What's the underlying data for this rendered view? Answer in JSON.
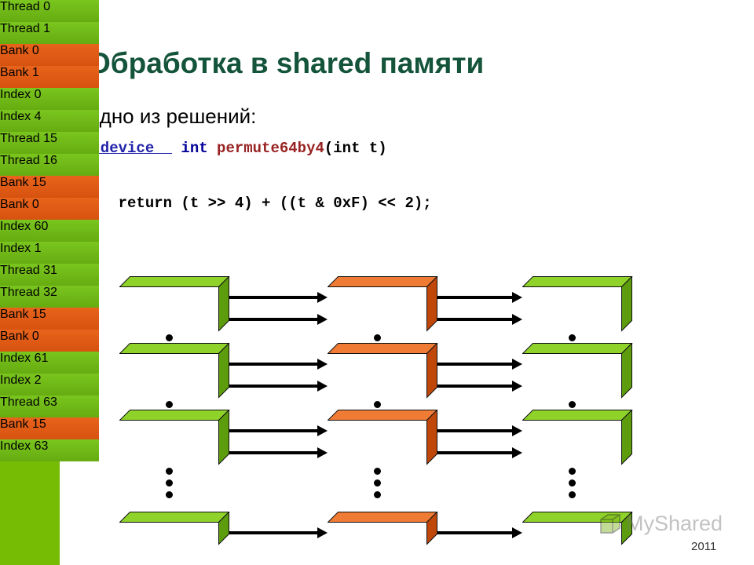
{
  "slide": {
    "title": "Обработка в shared памяти",
    "subtitle": "Одно из решений:",
    "title_color": "#14543b",
    "accent_bar_color": "#76bc05",
    "year": "2011"
  },
  "code": {
    "lines": [
      {
        "tokens": [
          {
            "text": "__device__",
            "kind": "keyword"
          },
          {
            "text": " int ",
            "kind": "keyword"
          },
          {
            "text": "permute64by4",
            "kind": "function"
          },
          {
            "text": "(int t)",
            "kind": "plain"
          }
        ]
      },
      {
        "tokens": [
          {
            "text": "{",
            "kind": "plain"
          }
        ]
      },
      {
        "tokens": [
          {
            "text": "    return (t >> 4) + ((t & 0xF) << 2);",
            "kind": "plain"
          }
        ]
      },
      {
        "tokens": [
          {
            "text": "}",
            "kind": "plain"
          }
        ]
      }
    ],
    "keyword_color": "#000099",
    "function_color": "#992222",
    "plain_color": "#000000"
  },
  "diagram": {
    "green_color": "#76bc05",
    "orange_color": "#e8641c",
    "columns": [
      {
        "name": "threads",
        "label_prefix": "Thread"
      },
      {
        "name": "banks",
        "label_prefix": "Bank"
      },
      {
        "name": "indices",
        "label_prefix": "Index"
      }
    ],
    "groups": [
      {
        "rows": [
          {
            "thread": "Thread 0",
            "bank": "Bank 0",
            "index": "Index 0"
          },
          {
            "thread": "Thread 1",
            "bank": "Bank 1",
            "index": "Index 4"
          }
        ]
      },
      {
        "rows": [
          {
            "thread": "Thread 15",
            "bank": "Bank 15",
            "index": "Index 60"
          },
          {
            "thread": "Thread 16",
            "bank": "Bank 0",
            "index": "Index 1"
          }
        ]
      },
      {
        "rows": [
          {
            "thread": "Thread 31",
            "bank": "Bank 15",
            "index": "Index 61"
          },
          {
            "thread": "Thread 32",
            "bank": "Bank 0",
            "index": "Index 2"
          }
        ]
      },
      {
        "rows": [
          {
            "thread": "Thread 63",
            "bank": "Bank 15",
            "index": "Index 63"
          }
        ]
      }
    ],
    "separators": [
      {
        "after_group": 0,
        "dots": 1
      },
      {
        "after_group": 1,
        "dots": 1
      },
      {
        "after_group": 2,
        "dots": 3
      }
    ]
  },
  "watermark": {
    "text": "MyShared",
    "logo_icon": "cube-icon"
  }
}
